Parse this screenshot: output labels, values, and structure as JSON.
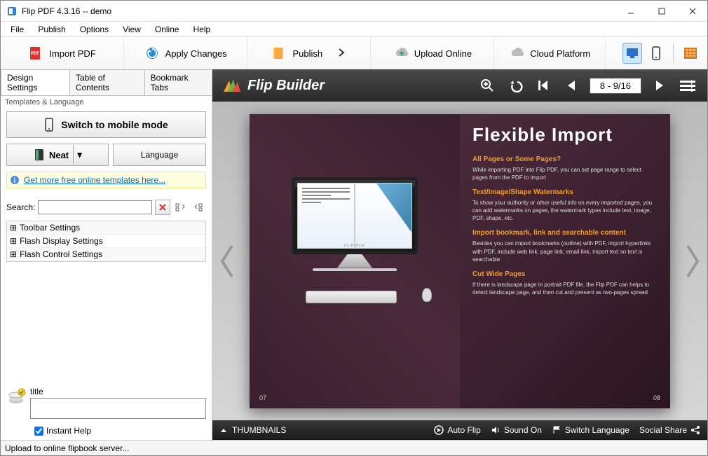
{
  "window": {
    "title": "Flip PDF 4.3.16  -- demo"
  },
  "menubar": [
    "File",
    "Publish",
    "Options",
    "View",
    "Online",
    "Help"
  ],
  "toolbar": {
    "import_pdf": "Import PDF",
    "apply_changes": "Apply Changes",
    "publish": "Publish",
    "upload_online": "Upload Online",
    "cloud_platform": "Cloud Platform"
  },
  "left": {
    "tabs": {
      "design": "Design Settings",
      "toc": "Table of Contents",
      "bookmark": "Bookmark Tabs"
    },
    "templates_label": "Templates & Language",
    "switch_mobile": "Switch to mobile mode",
    "theme": "Neat",
    "language_btn": "Language",
    "more_templates": "Get more free online templates here...",
    "search_label": "Search:",
    "tree": {
      "toolbar": "Toolbar Settings",
      "flash_display": "Flash Display Settings",
      "flash_control": "Flash Control Settings"
    },
    "title_label": "title",
    "instant_help": "Instant Help"
  },
  "preview": {
    "brand": "Flip Builder",
    "page_indicator": "8 - 9/16",
    "page_left_num": "07",
    "page_right_num": "08",
    "monitor_label": "FLIP PDF",
    "headline": "Flexible Import",
    "sec1_h": "All Pages or Some Pages?",
    "sec1_t": "While importing PDF into Flip PDF, you can set page range to select pages from the PDF to import",
    "sec2_h": "Text/Image/Shape Watermarks",
    "sec2_t": "To show your authority or other useful info on every imported pages, you can add watermarks on pages, the watermark types include text, image, PDF, shape, etc.",
    "sec3_h": "Import bookmark, link and searchable content",
    "sec3_t": "Besides you can import bookmarks (outline) with PDF, import hyperlinks with PDF, include web link, page link, email link, import text so text is searchable",
    "sec4_h": "Cut Wide Pages",
    "sec4_t": "If there is landscape page in portrait PDF file, the Flip PDF can helps to detect landscape page, and then cut and present as two-pages spread",
    "bottom": {
      "thumbnails": "THUMBNAILS",
      "auto_flip": "Auto Flip",
      "sound_on": "Sound On",
      "switch_lang": "Switch Language",
      "social_share": "Social Share"
    }
  },
  "statusbar": "Upload to online flipbook server..."
}
